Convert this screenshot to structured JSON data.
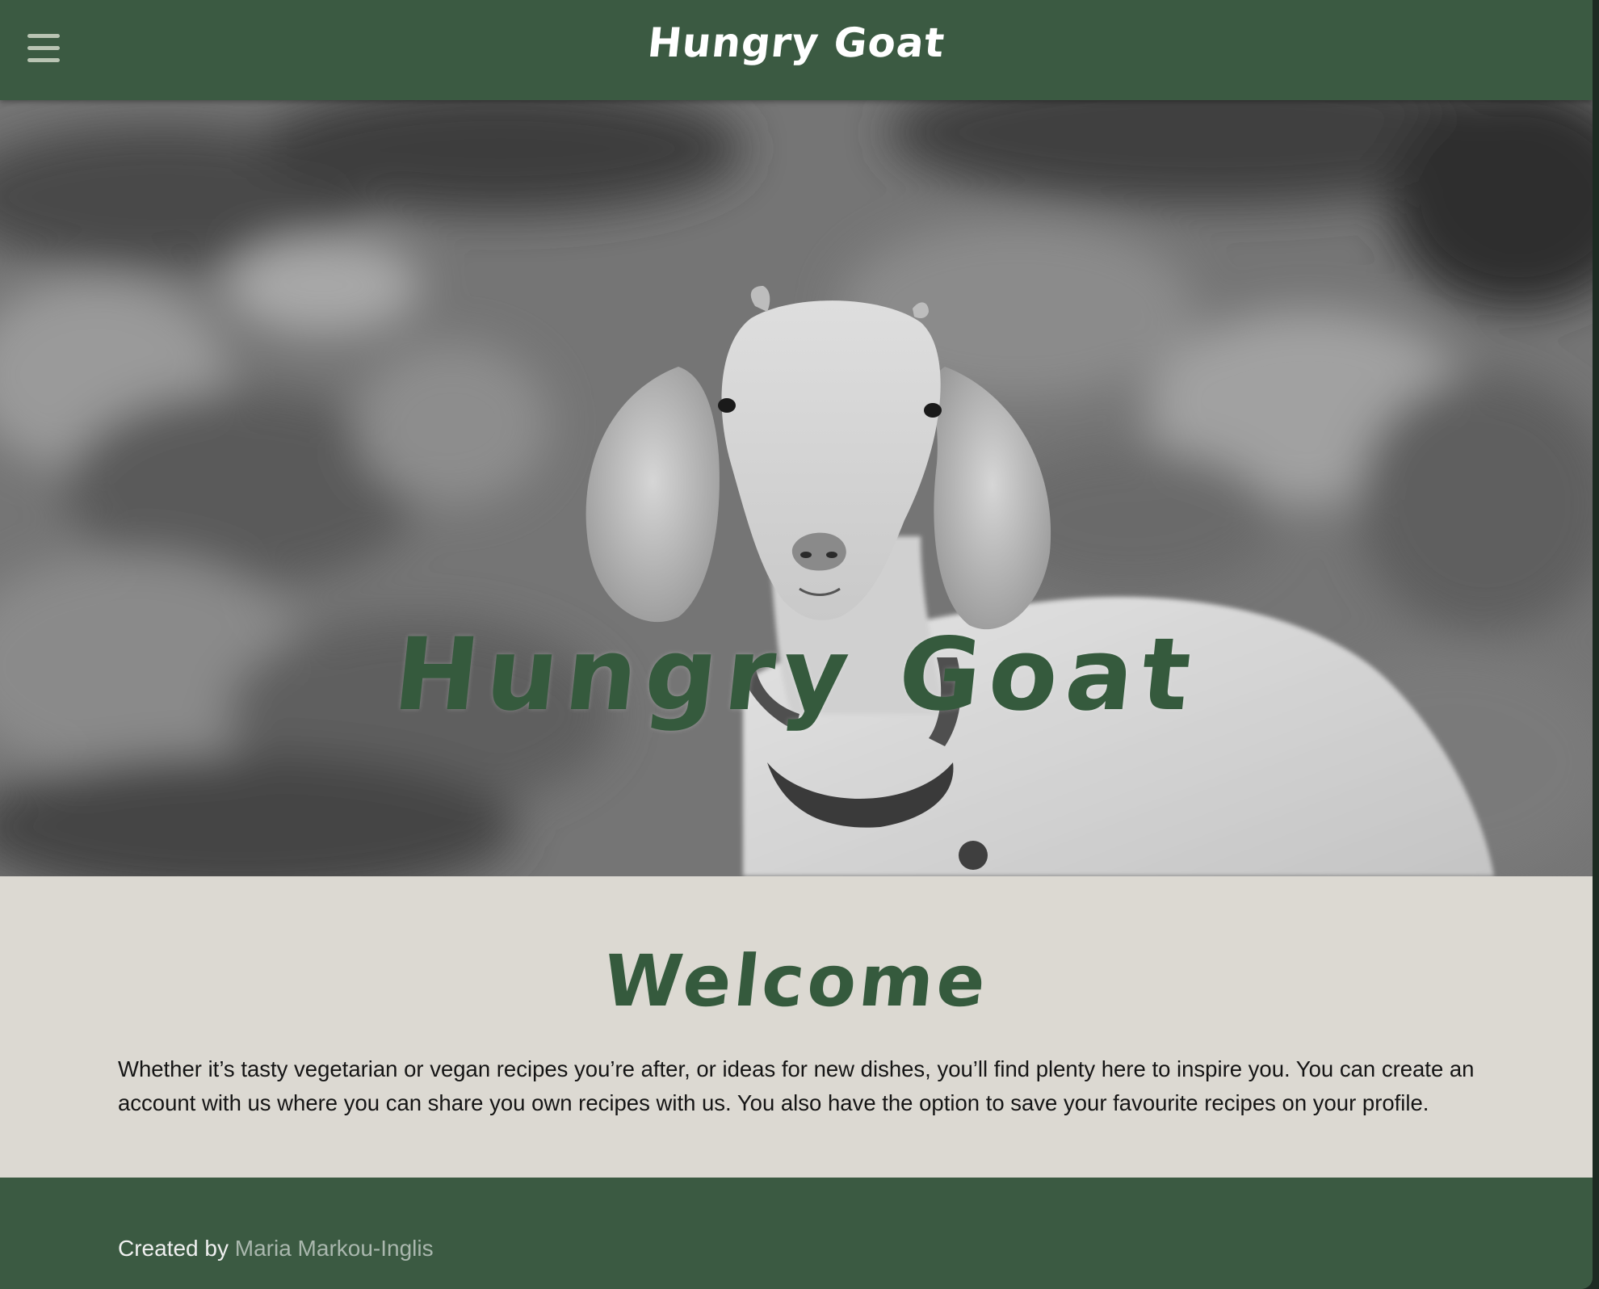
{
  "navbar": {
    "brand": "Hungry Goat",
    "menu_icon": "hamburger-menu-icon",
    "background": "#3b5a42"
  },
  "hero": {
    "title": "Hungry Goat",
    "title_color": "#355a3d",
    "image": "black-and-white-goat-photo"
  },
  "welcome": {
    "heading": "Welcome",
    "body": "Whether it’s tasty vegetarian or vegan recipes you’re after, or ideas for new dishes, you’ll find plenty here to inspire you. You can create an account with us where you can share you own recipes with us. You also have the option to save your favourite recipes on your profile.",
    "background": "#dcd9d2"
  },
  "footer": {
    "prefix": "Created by",
    "author": "Maria Markou-Inglis",
    "link_color": "#a9b7ad"
  }
}
